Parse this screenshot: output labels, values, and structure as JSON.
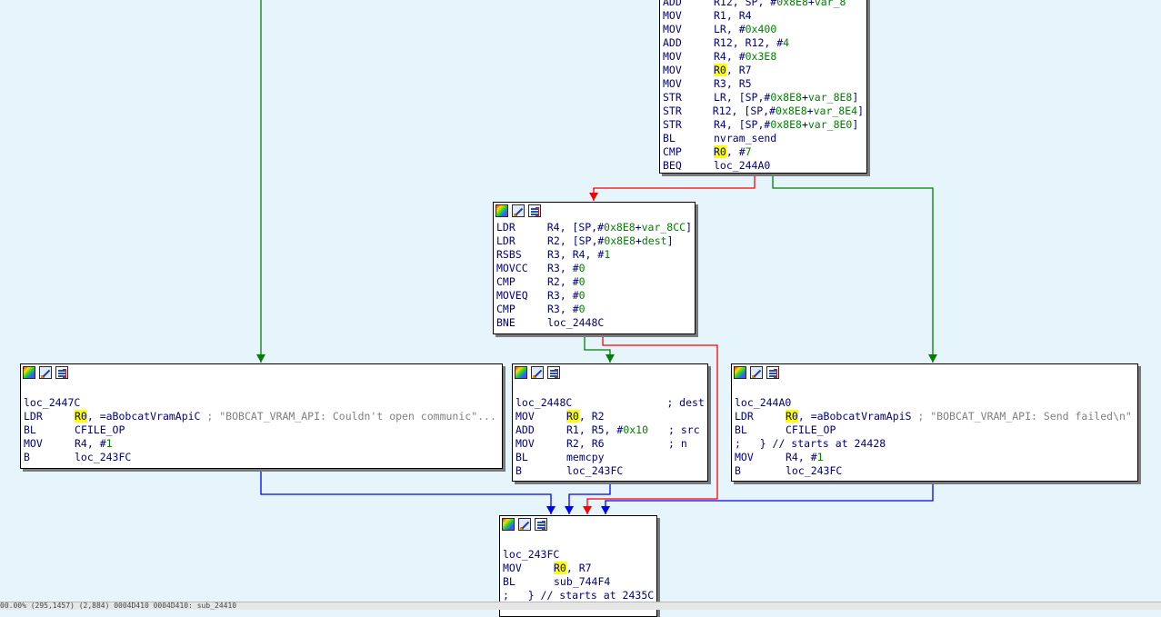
{
  "colors": {
    "background": "#e6f4fb",
    "edge_true": "#008000",
    "edge_false": "#ff0000",
    "edge_uncond": "#0000ff",
    "highlight": "#ffff00"
  },
  "icons": [
    "color-palette-icon",
    "rename-node-icon",
    "group-nodes-icon"
  ],
  "nodes": {
    "top": {
      "lines": [
        {
          "mn": "ADD",
          "ops": "R12, SP, #0x8E8+var_8"
        },
        {
          "mn": "MOV",
          "ops": "R1, R4"
        },
        {
          "mn": "MOV",
          "ops": "LR, #0x400"
        },
        {
          "mn": "ADD",
          "ops": "R12, R12, #4"
        },
        {
          "mn": "MOV",
          "ops": "R4, #0x3E8"
        },
        {
          "mn": "MOV",
          "ops": "R0, R7"
        },
        {
          "mn": "MOV",
          "ops": "R3, R5"
        },
        {
          "mn": "STR",
          "ops": "LR, [SP,#0x8E8+var_8E8]"
        },
        {
          "mn": "STR",
          "ops": "R12, [SP,#0x8E8+var_8E4]"
        },
        {
          "mn": "STR",
          "ops": "R4, [SP,#0x8E8+var_8E0]"
        },
        {
          "mn": "BL",
          "ops": "nvram_send"
        },
        {
          "mn": "CMP",
          "ops": "R0, #7"
        },
        {
          "mn": "BEQ",
          "ops": "loc_244A0"
        }
      ]
    },
    "middle": {
      "lines": [
        {
          "mn": "LDR",
          "ops": "R4, [SP,#0x8E8+var_8CC]"
        },
        {
          "mn": "LDR",
          "ops": "R2, [SP,#0x8E8+dest]"
        },
        {
          "mn": "RSBS",
          "ops": "R3, R4, #1"
        },
        {
          "mn": "MOVCC",
          "ops": "R3, #0"
        },
        {
          "mn": "CMP",
          "ops": "R2, #0"
        },
        {
          "mn": "MOVEQ",
          "ops": "R3, #0"
        },
        {
          "mn": "CMP",
          "ops": "R3, #0"
        },
        {
          "mn": "BNE",
          "ops": "loc_2448C"
        }
      ]
    },
    "left": {
      "label": "loc_2447C",
      "lines": [
        {
          "mn": "LDR",
          "ops": "R0, =aBobcatVramApiC",
          "comment": " ; \"BOBCAT_VRAM_API: Couldn't open communic\"..."
        },
        {
          "mn": "BL",
          "ops": "CFILE_OP"
        },
        {
          "mn": "MOV",
          "ops": "R4, #1"
        },
        {
          "mn": "B",
          "ops": "loc_243FC"
        }
      ]
    },
    "center": {
      "label": "loc_2448C",
      "label_comment": "; dest",
      "lines": [
        {
          "mn": "MOV",
          "ops": "R0, R2",
          "comment": ""
        },
        {
          "mn": "ADD",
          "ops": "R1, R5, #0x10",
          "comment": "; src"
        },
        {
          "mn": "MOV",
          "ops": "R2, R6",
          "comment": "; n"
        },
        {
          "mn": "BL",
          "ops": "memcpy",
          "comment": ""
        },
        {
          "mn": "B",
          "ops": "loc_243FC",
          "comment": ""
        }
      ]
    },
    "right": {
      "label": "loc_244A0",
      "lines": [
        {
          "mn": "LDR",
          "ops": "R0, =aBobcatVramApiS",
          "comment": " ; \"BOBCAT_VRAM_API: Send failed\\n\""
        },
        {
          "mn": "BL",
          "ops": "CFILE_OP"
        },
        {
          "mn": "",
          "ops": ";   } // starts at 24428",
          "raw": true
        },
        {
          "mn": "MOV",
          "ops": "R4, #1"
        },
        {
          "mn": "B",
          "ops": "loc_243FC"
        }
      ]
    },
    "bottom": {
      "label": "loc_243FC",
      "lines": [
        {
          "mn": "MOV",
          "ops": "R0, R7"
        },
        {
          "mn": "BL",
          "ops": "sub_744F4"
        },
        {
          "mn": "",
          "ops": ";   } // starts at 2435C",
          "raw": true
        }
      ]
    }
  },
  "statusbar": {
    "text": "00.00% (295,1457) (2,884) 0004D410 0004D410: sub_24410"
  }
}
